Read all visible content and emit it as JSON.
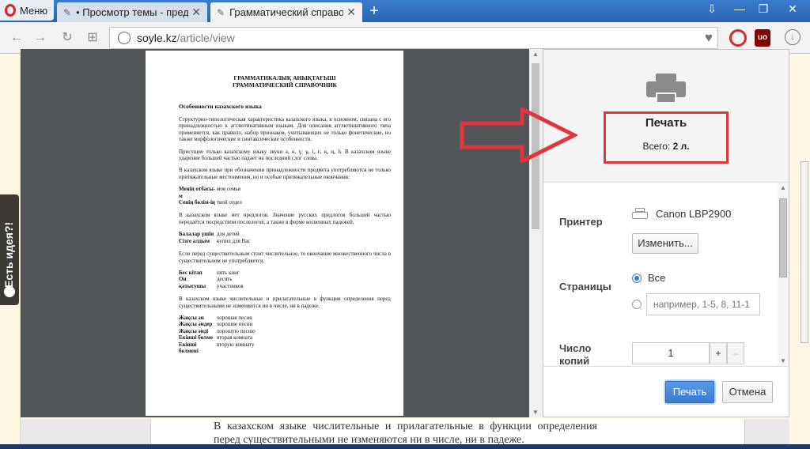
{
  "browser": {
    "menu_label": "Меню",
    "tabs": [
      {
        "title": "• Просмотр темы - предл",
        "active": false
      },
      {
        "title": "Грамматический справоч",
        "active": true
      }
    ],
    "new_tab": "+",
    "window_controls": [
      "⇩",
      "—",
      "❐",
      "✕"
    ],
    "address_host": "soyle.kz",
    "address_path": "/article/view",
    "ext_ub_label": "uo"
  },
  "side_tab": {
    "label": "Есть идея?!"
  },
  "preview": {
    "title_kz": "ГРАММАТИКАЛЫҚ АНЫҚТАҒЫШ",
    "title_ru": "ГРАММАТИЧЕСКИЙ СПРАВОЧНИК",
    "heading": "Особенности казахского языка",
    "p1": "Структурно-типологическая характеристика казахского языка, в основном, связана с его принадлежностью к агглютинативным языкам. Для описания агглютинативного типа применяется, как правило, набор признаков, учитывающих не только фонетические, но также морфологические и синтаксические особенности.",
    "p2": "Присущие только казахскому языку звуки ә, ө, ү, ұ, і, ғ, қ, ң, һ. В казахском языке ударение большей частью падает на последний слог слова.",
    "p3": "В казахском языке при обозначении принадлежности предмета употребляются не только притяжательные местоимения, но и особые притяжательные окончания:",
    "pairs1": [
      {
        "k": "Менің отбасы-м",
        "v": "моя семья"
      },
      {
        "k": "Сенің бөлім-ің",
        "v": "твой отдел"
      }
    ],
    "p4": "В казахском языке нет предлогов. Значение русских предлогов большей частью передаётся посредством послелогов, а также в форме косвенных падежей.",
    "pairs2": [
      {
        "k": "Балалар үшін",
        "v": "для детей"
      },
      {
        "k": "Сізге алдым",
        "v": "купил для Вас"
      }
    ],
    "p5": "Если перед существительным стоит числительное, то окончание множественного числа в существительном не употребляется.",
    "pairs3": [
      {
        "k": "Бес кітап",
        "v": "пять книг"
      },
      {
        "k": "Он",
        "v": "десять"
      },
      {
        "k": "қатысушы",
        "v": "участников"
      }
    ],
    "p6": "В казахском языке числительные и прилагательные в функции определения перед существительными не изменяются ни в числе, ни в падеже.",
    "pairs4": [
      {
        "k": "Жақсы ән",
        "v": "хорошая песня"
      },
      {
        "k": "Жақсы әндер",
        "v": "хорошие песни"
      },
      {
        "k": "Жақсы әнді",
        "v": "хорошую песню"
      },
      {
        "k": "Екінші бөлме",
        "v": "вторая комната"
      },
      {
        "k": "Екінші бөлмені",
        "v": "вторую комнату"
      }
    ]
  },
  "print_panel": {
    "title": "Печать",
    "total_label": "Всего:",
    "total_value": "2 л.",
    "printer_label": "Принтер",
    "printer_name": "Canon LBP2900",
    "change_button": "Изменить...",
    "pages_label": "Страницы",
    "pages_all": "Все",
    "pages_placeholder": "например, 1-5, 8, 11-1",
    "copies_label_1": "Число",
    "copies_label_2": "копий",
    "copies_value": "1",
    "plus": "+",
    "minus": "–",
    "print_button": "Печать",
    "cancel_button": "Отмена"
  },
  "page_behind": {
    "text": "В казахском языке числительные и прилагательные в функции определения перед существительными не изменяются ни в числе, ни в падеже."
  },
  "colors": {
    "highlight": "#e0353c",
    "accent": "#3a7cd5",
    "tabstrip": "#2a64ad"
  }
}
